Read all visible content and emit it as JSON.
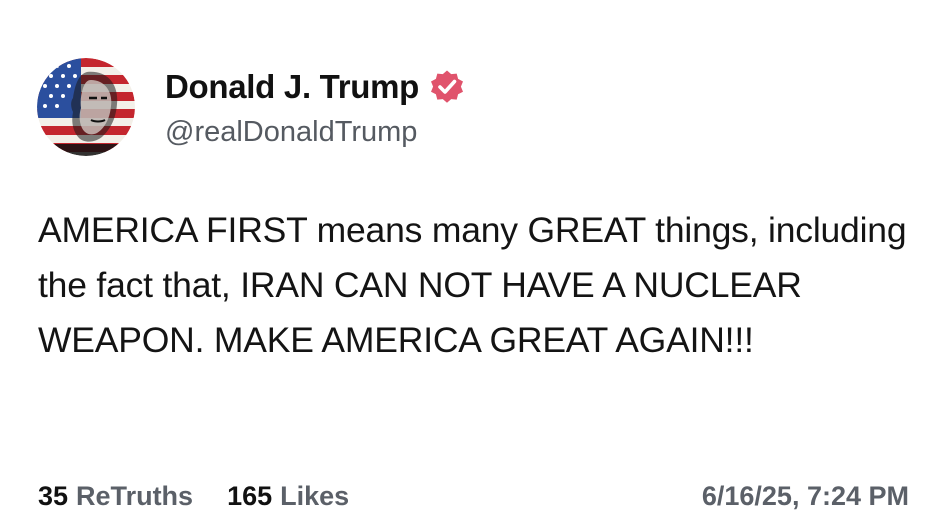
{
  "author": {
    "display_name": "Donald J. Trump",
    "handle": "@realDonaldTrump",
    "verified_icon": "verified-badge-icon",
    "badge_color": "#e0536c"
  },
  "post": {
    "text": "AMERICA FIRST means many GREAT things, including the fact that, IRAN CAN NOT HAVE A NUCLEAR WEAPON. MAKE AMERICA GREAT AGAIN!!!"
  },
  "stats": {
    "retruths_count": "35",
    "retruths_label": "ReTruths",
    "likes_count": "165",
    "likes_label": "Likes"
  },
  "timestamp": "6/16/25, 7:24 PM"
}
